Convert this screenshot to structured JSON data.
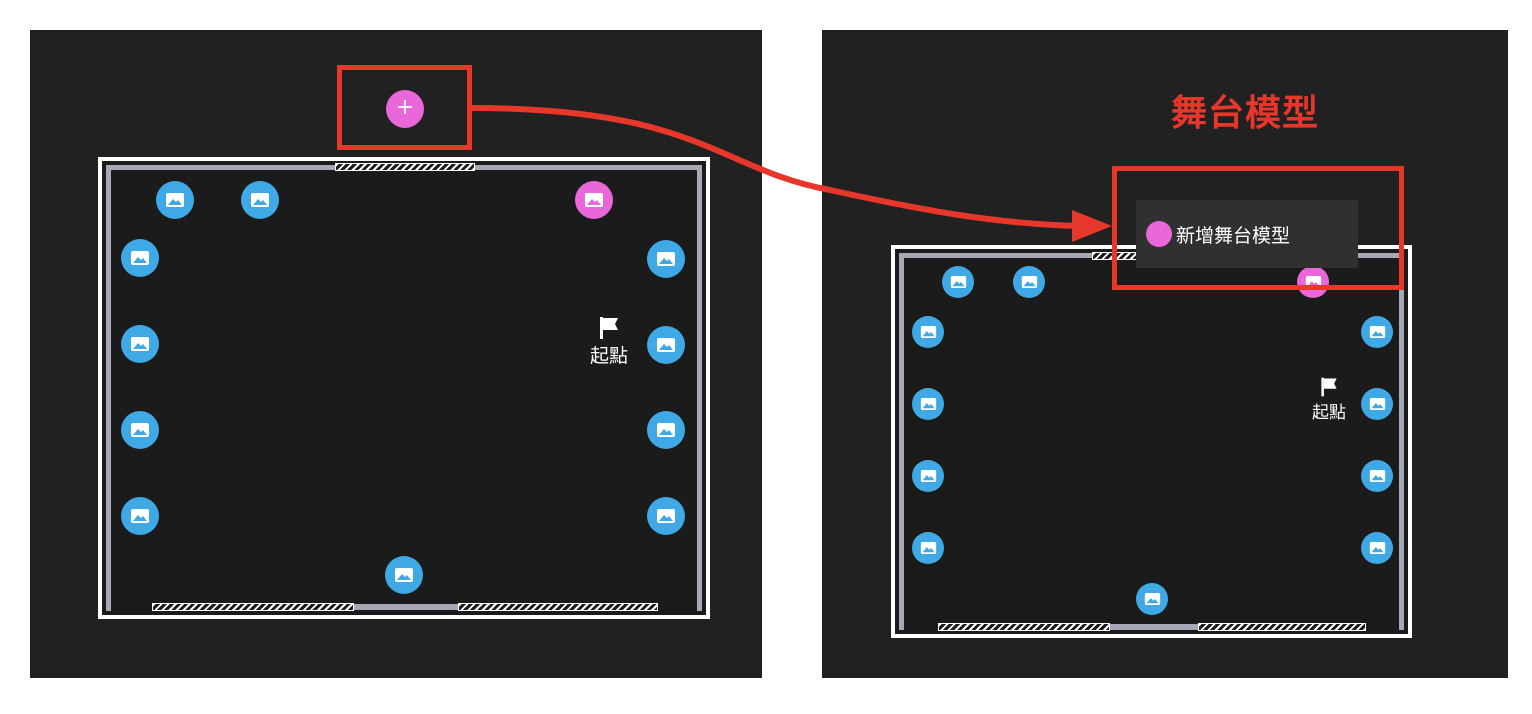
{
  "annotation": {
    "title": "舞台模型",
    "accent_color": "#e7372b"
  },
  "left_panel": {
    "add_button": {
      "symbol": "+",
      "color": "#ea67d9"
    },
    "start_label": "起點",
    "spot_icon": "image-icon"
  },
  "right_panel": {
    "menu_item_label": "新增舞台模型",
    "start_label": "起點",
    "spot_icon": "image-icon"
  },
  "colors": {
    "spot_blue": "#3fa9e6",
    "spot_pink": "#ea67d9",
    "background": "#212121"
  }
}
